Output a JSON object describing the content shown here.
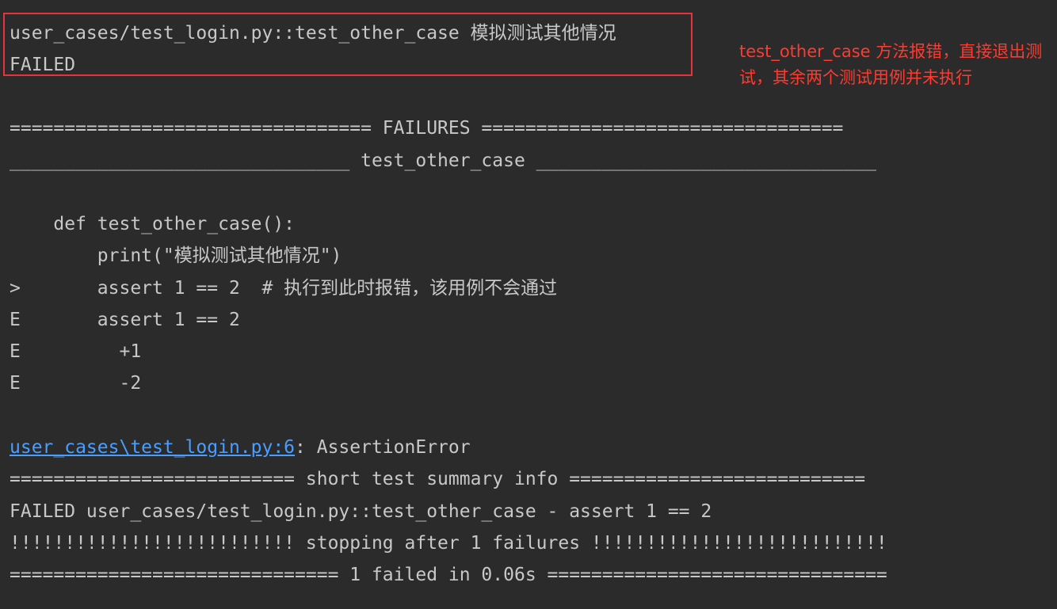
{
  "header": {
    "test_id": "user_cases/test_login.py::test_other_case 模拟测试其他情况",
    "status": "FAILED"
  },
  "annotation": {
    "text": "test_other_case 方法报错，直接退出测试，其余两个测试用例并未执行"
  },
  "failures": {
    "banner": "================================= FAILURES =================================",
    "case_header": "_______________________________ test_other_case _______________________________",
    "code": [
      "    def test_other_case():",
      "        print(\"模拟测试其他情况\")",
      ">       assert 1 == 2  # 执行到此时报错，该用例不会通过",
      "E       assert 1 == 2",
      "E         +1",
      "E         -2"
    ],
    "error_location_link": "user_cases\\test_login.py:6",
    "error_type": ": AssertionError"
  },
  "summary": {
    "banner": "========================== short test summary info ===========================",
    "failed_line": "FAILED user_cases/test_login.py::test_other_case - assert 1 == 2",
    "stopping_line": "!!!!!!!!!!!!!!!!!!!!!!!!!! stopping after 1 failures !!!!!!!!!!!!!!!!!!!!!!!!!!!",
    "result_line": "============================== 1 failed in 0.06s ==============================="
  },
  "colors": {
    "background": "#2b2b2b",
    "text": "#c8c8c8",
    "link": "#4a9eff",
    "annotation": "#ff3b30",
    "highlight_border": "#e8333d"
  }
}
